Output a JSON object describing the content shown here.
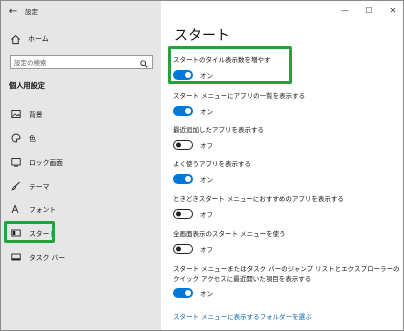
{
  "window": {
    "app_title": "設定",
    "controls": {
      "minimize": "—",
      "maximize": "☐",
      "close": "✕"
    }
  },
  "sidebar": {
    "home_label": "ホーム",
    "search_placeholder": "設定の検索",
    "section_label": "個人用設定",
    "items": [
      {
        "label": "背景",
        "icon": "picture-icon"
      },
      {
        "label": "色",
        "icon": "palette-icon"
      },
      {
        "label": "ロック画面",
        "icon": "lock-screen-icon"
      },
      {
        "label": "テーマ",
        "icon": "brush-icon"
      },
      {
        "label": "フォント",
        "icon": "font-icon"
      },
      {
        "label": "スタート",
        "icon": "start-icon",
        "active": true
      },
      {
        "label": "タスク バー",
        "icon": "taskbar-icon"
      }
    ]
  },
  "main": {
    "title": "スタート",
    "settings": [
      {
        "desc": "スタートのタイル表示数を増やす",
        "on": true,
        "state": "オン"
      },
      {
        "desc": "スタート メニューにアプリの一覧を表示する",
        "on": true,
        "state": "オン"
      },
      {
        "desc": "最近追加したアプリを表示する",
        "on": false,
        "state": "オフ"
      },
      {
        "desc": "よく使うアプリを表示する",
        "on": true,
        "state": "オン"
      },
      {
        "desc": "ときどきスタート メニューにおすすめのアプリを表示する",
        "on": false,
        "state": "オフ"
      },
      {
        "desc": "全画面表示のスタート メニューを使う",
        "on": false,
        "state": "オフ"
      },
      {
        "desc": "スタート メニューまたはタスク バーのジャンプ リストとエクスプローラーのクイック アクセスに最近開いた項目を表示する",
        "on": true,
        "state": "オン"
      }
    ],
    "folders_link": "スタート メニューに表示するフォルダーを選ぶ"
  },
  "colors": {
    "accent": "#0078d7",
    "highlight": "#23a43a",
    "sidebar_bg": "#e6e6e6"
  }
}
